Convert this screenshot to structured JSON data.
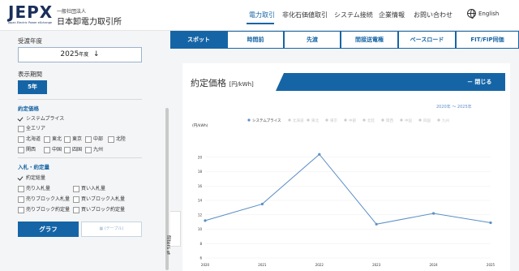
{
  "header": {
    "logo_text": "JEPX",
    "logo_en": "Japan Electric Power eXchange",
    "logo_ja_small": "一般社団法人",
    "logo_ja": "日本卸電力取引所",
    "nav": [
      "電力取引",
      "非化石価値取引",
      "システム接続",
      "企業情報",
      "お問い合わせ"
    ],
    "nav_active": 0,
    "lang": "English"
  },
  "sidebar": {
    "fiscal_year_label": "受渡年度",
    "fiscal_year_value": "2025",
    "fiscal_year_suffix": "年度",
    "fiscal_year_arrow": "↓",
    "period_label": "表示期間",
    "period_value": "5年",
    "contract_price_label": "約定価格",
    "price_options": [
      {
        "label": "システムプライス",
        "checked": true
      },
      {
        "label": "全エリア",
        "checked": false
      },
      {
        "label": "北海道",
        "checked": false
      },
      {
        "label": "東北",
        "checked": false
      },
      {
        "label": "東京",
        "checked": false
      },
      {
        "label": "中部",
        "checked": false
      },
      {
        "label": "北陸",
        "checked": false
      },
      {
        "label": "関西",
        "checked": false
      },
      {
        "label": "中国",
        "checked": false
      },
      {
        "label": "四国",
        "checked": false
      },
      {
        "label": "九州",
        "checked": false
      }
    ],
    "bid_label": "入札・約定量",
    "bid_options": [
      {
        "label": "約定総量",
        "checked": true
      },
      {
        "label": "売り入札量",
        "checked": false
      },
      {
        "label": "買い入札量",
        "checked": false
      },
      {
        "label": "売りブロック入札量",
        "checked": false
      },
      {
        "label": "買いブロック入札量",
        "checked": false
      },
      {
        "label": "売りブロック約定量",
        "checked": false
      },
      {
        "label": "買いブロック約定量",
        "checked": false
      }
    ],
    "graph_button": "グラフ",
    "table_button": "(テーブル)",
    "filters_label": "filters"
  },
  "tabs": [
    {
      "label": "スポット",
      "active": true
    },
    {
      "label": "時間前",
      "active": false
    },
    {
      "label": "先渡",
      "active": false
    },
    {
      "label": "間接送電権",
      "active": false
    },
    {
      "label": "ベースロード",
      "active": false
    },
    {
      "label": "FIT/FIP同価",
      "active": false
    }
  ],
  "card": {
    "title": "約定価格",
    "unit": "[円/kWh]",
    "close_label": "－ 閉じる"
  },
  "chart_range": "2020年 〜 2025年",
  "colors": {
    "accent": "#1565a6",
    "line": "#5b8fc7"
  },
  "chart_data": {
    "type": "line",
    "ylabel": "(円/kWh)",
    "ylim": [
      6,
      22
    ],
    "yticks": [
      6,
      8,
      10,
      12,
      14,
      16,
      18,
      20
    ],
    "categories": [
      "2020",
      "2021",
      "2022",
      "2023",
      "2024",
      "2025"
    ],
    "legend": [
      "システムプライス",
      "北海道",
      "東北",
      "東京",
      "中部",
      "北陸",
      "関西",
      "中国",
      "四国",
      "九州"
    ],
    "series": [
      {
        "name": "システムプライス",
        "values": [
          11.2,
          13.5,
          20.4,
          10.7,
          12.2,
          10.9
        ]
      }
    ],
    "grid": true
  }
}
